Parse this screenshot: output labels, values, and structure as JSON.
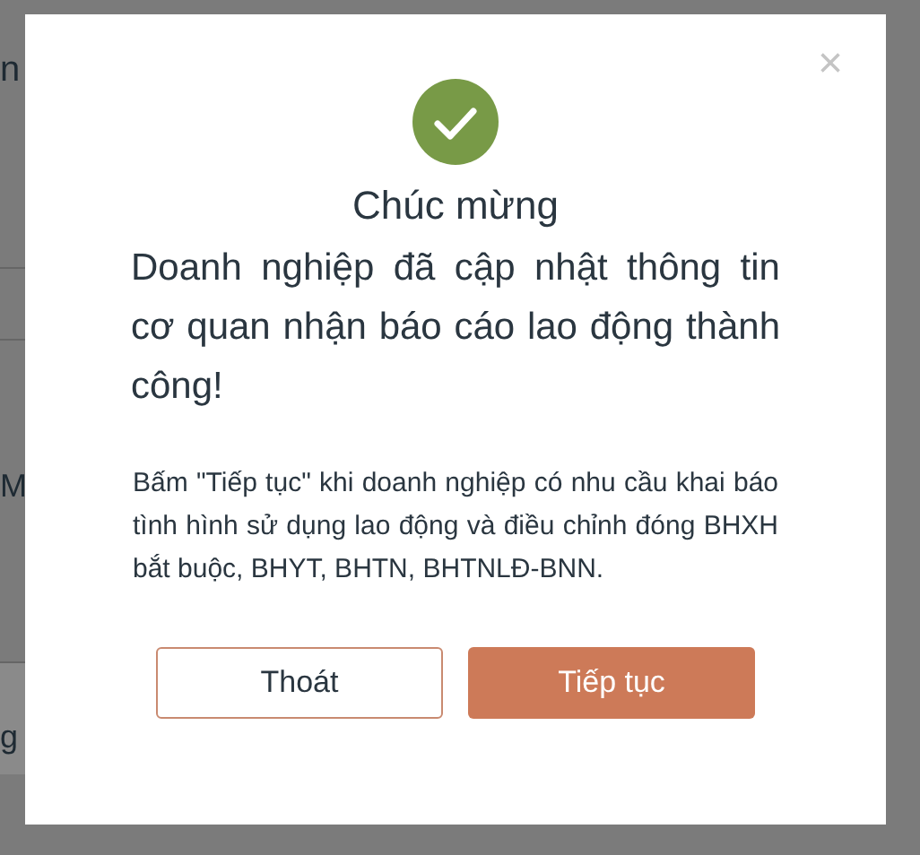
{
  "background": {
    "fragments": [
      "n",
      "M",
      "g"
    ]
  },
  "dialog": {
    "close": "×",
    "title": "Chúc mừng",
    "message": "Doanh nghiệp đã cập nhật thông tin cơ quan nhận báo cáo lao động thành công!",
    "note": "Bấm \"Tiếp tục\" khi doanh nghiệp có nhu cầu khai báo tình hình sử dụng lao động và điều chỉnh đóng BHXH bắt buộc, BHYT, BHTN, BHTNLĐ-BNN.",
    "buttons": [
      {
        "label": "Thoát",
        "kind": "secondary"
      },
      {
        "label": "Tiếp tục",
        "kind": "primary"
      }
    ]
  }
}
